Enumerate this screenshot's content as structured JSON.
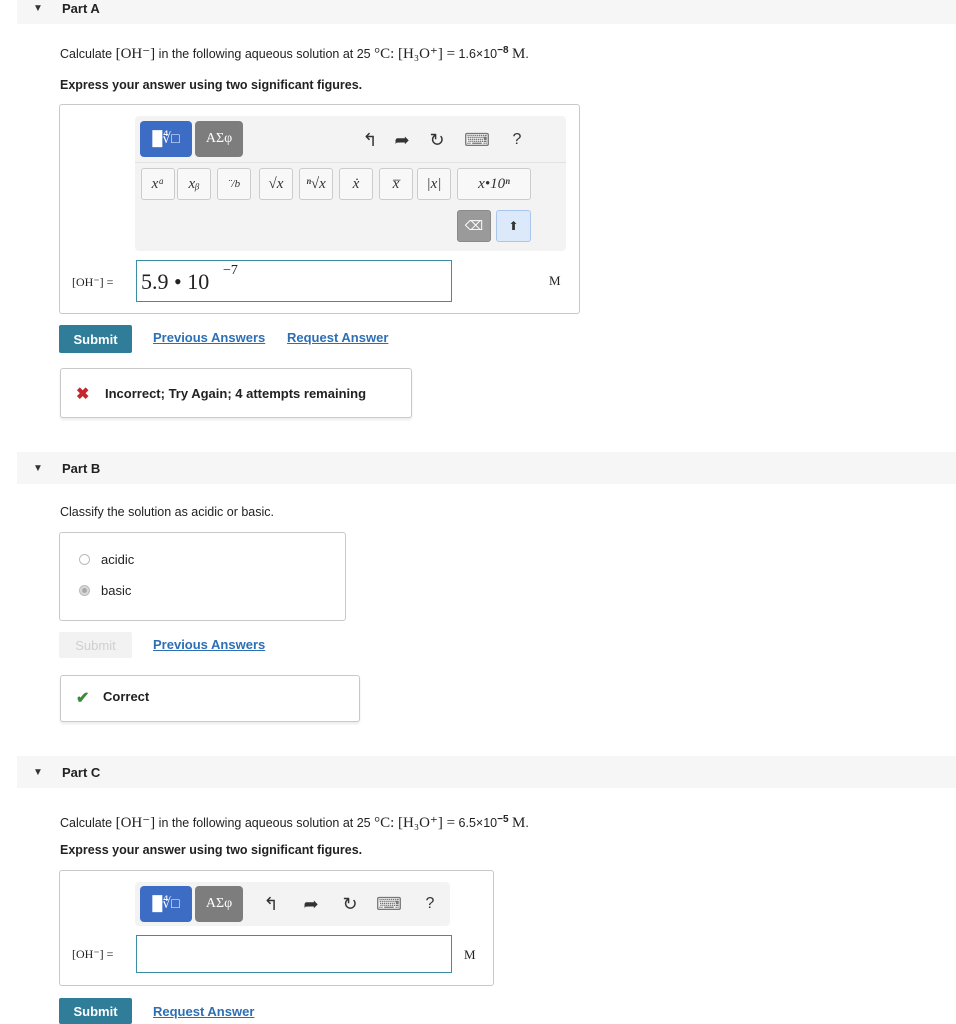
{
  "partA": {
    "title": "Part A",
    "question_prefix": "Calculate",
    "question_oh": "[OH⁻]",
    "question_mid": "in the following aqueous solution at 25",
    "question_temp": "°C: [H₃O⁺] =",
    "question_value": "1.6×10",
    "question_exp": "−8",
    "question_unit": "M",
    "question_end": ".",
    "instruction": "Express your answer using two significant figures.",
    "toolbar_templates": "█∜□",
    "toolbar_greek": "ΑΣφ",
    "keys": [
      "xᵃ",
      "xᵦ",
      "¨/b",
      "√x",
      "ⁿ√x",
      "ẋ",
      "x̅",
      "|x|",
      "x•10ⁿ"
    ],
    "help": "?",
    "answer_label": "[OH⁻] =",
    "answer_mantissa": "5.9 • 10",
    "answer_exp": "−7",
    "unit": "M",
    "submit": "Submit",
    "previous_answers": "Previous Answers",
    "request_answer": "Request Answer",
    "feedback_icon": "✖",
    "feedback": "Incorrect; Try Again; 4 attempts remaining",
    "feedback_color": "#c8242e"
  },
  "partB": {
    "title": "Part B",
    "question": "Classify the solution as acidic or basic.",
    "options": [
      {
        "label": "acidic",
        "checked": false
      },
      {
        "label": "basic",
        "checked": true
      }
    ],
    "submit": "Submit",
    "previous_answers": "Previous Answers",
    "feedback_icon": "✔",
    "feedback": "Correct",
    "feedback_color": "#3a8a3a"
  },
  "partC": {
    "title": "Part C",
    "question_prefix": "Calculate",
    "question_oh": "[OH⁻]",
    "question_mid": "in the following aqueous solution at 25",
    "question_temp": "°C: [H₃O⁺] =",
    "question_value": "6.5×10",
    "question_exp": "−5",
    "question_unit": "M",
    "question_end": ".",
    "instruction": "Express your answer using two significant figures.",
    "toolbar_templates": "█∜□",
    "toolbar_greek": "ΑΣφ",
    "help": "?",
    "answer_label": "[OH⁻] =",
    "unit": "M",
    "submit": "Submit",
    "request_answer": "Request Answer"
  },
  "icons": {
    "caret": "▼",
    "undo": "↰",
    "redo": "➦",
    "reset": "↻",
    "keyboard": "⌨",
    "backspace": "⌫",
    "keyboard_toggle": "⬆"
  }
}
